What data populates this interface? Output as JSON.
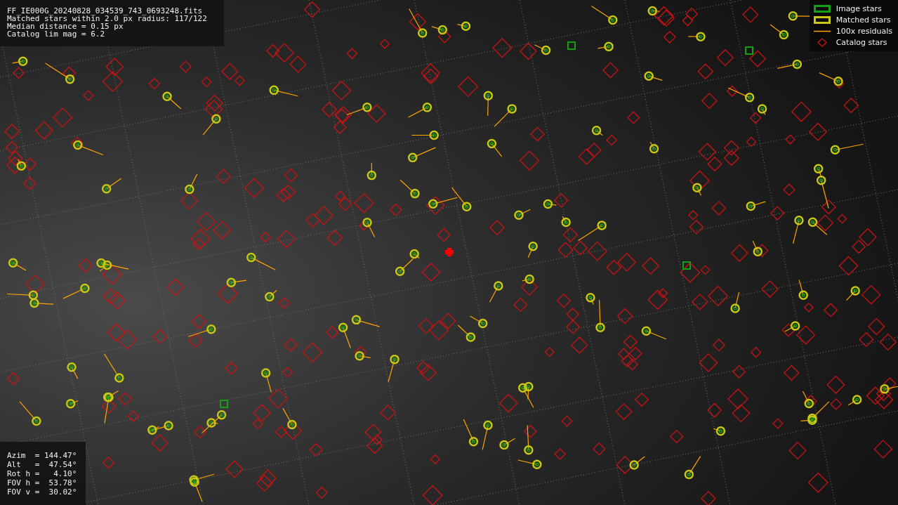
{
  "header_info": {
    "lines": [
      "FF_IE000G_20240828_034539_743_0693248.fits",
      "Matched stars within 2.0 px radius: 117/122",
      "Median distance = 0.15 px",
      "Catalog lim mag = 6.2"
    ]
  },
  "legend": [
    {
      "kind": "box",
      "color": "#14a014",
      "label": "Image stars"
    },
    {
      "kind": "box",
      "color": "#c8c814",
      "label": "Matched stars"
    },
    {
      "kind": "line",
      "color": "#ffa500",
      "label": "100x residuals"
    },
    {
      "kind": "diamond",
      "color": "#c81414",
      "label": "Catalog stars"
    }
  ],
  "pointing_info": {
    "lines": [
      "Azim  = 144.47°",
      "Alt   =  47.54°",
      "Rot h =   4.10°",
      "FOV h =  53.78°",
      "FOV v =  30.02°"
    ]
  }
}
